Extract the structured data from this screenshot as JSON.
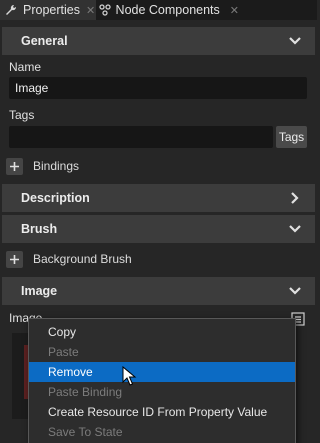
{
  "tabs": [
    {
      "label": "Properties",
      "active": true,
      "icon": "wrench-icon"
    },
    {
      "label": "Node Components",
      "active": false,
      "icon": "components-icon"
    }
  ],
  "sections": {
    "general": "General",
    "description": "Description",
    "brush": "Brush",
    "image": "Image"
  },
  "fields": {
    "name_label": "Name",
    "name_value": "Image",
    "tags_label": "Tags",
    "tags_value": "",
    "tags_button": "Tags",
    "image_label": "Image"
  },
  "rows": {
    "bindings": "Bindings",
    "background_brush": "Background Brush"
  },
  "context_menu": [
    {
      "label": "Copy",
      "enabled": true,
      "selected": false
    },
    {
      "label": "Paste",
      "enabled": false,
      "selected": false
    },
    {
      "label": "Remove",
      "enabled": true,
      "selected": true
    },
    {
      "label": "Paste Binding",
      "enabled": false,
      "selected": false
    },
    {
      "label": "Create Resource ID From Property Value",
      "enabled": true,
      "selected": false
    },
    {
      "label": "Save To State",
      "enabled": false,
      "selected": false
    }
  ],
  "colors": {
    "background": "#262626",
    "section_header": "#3c3c3c",
    "menu_highlight": "#0c6bc4",
    "field_bg": "#161616"
  }
}
